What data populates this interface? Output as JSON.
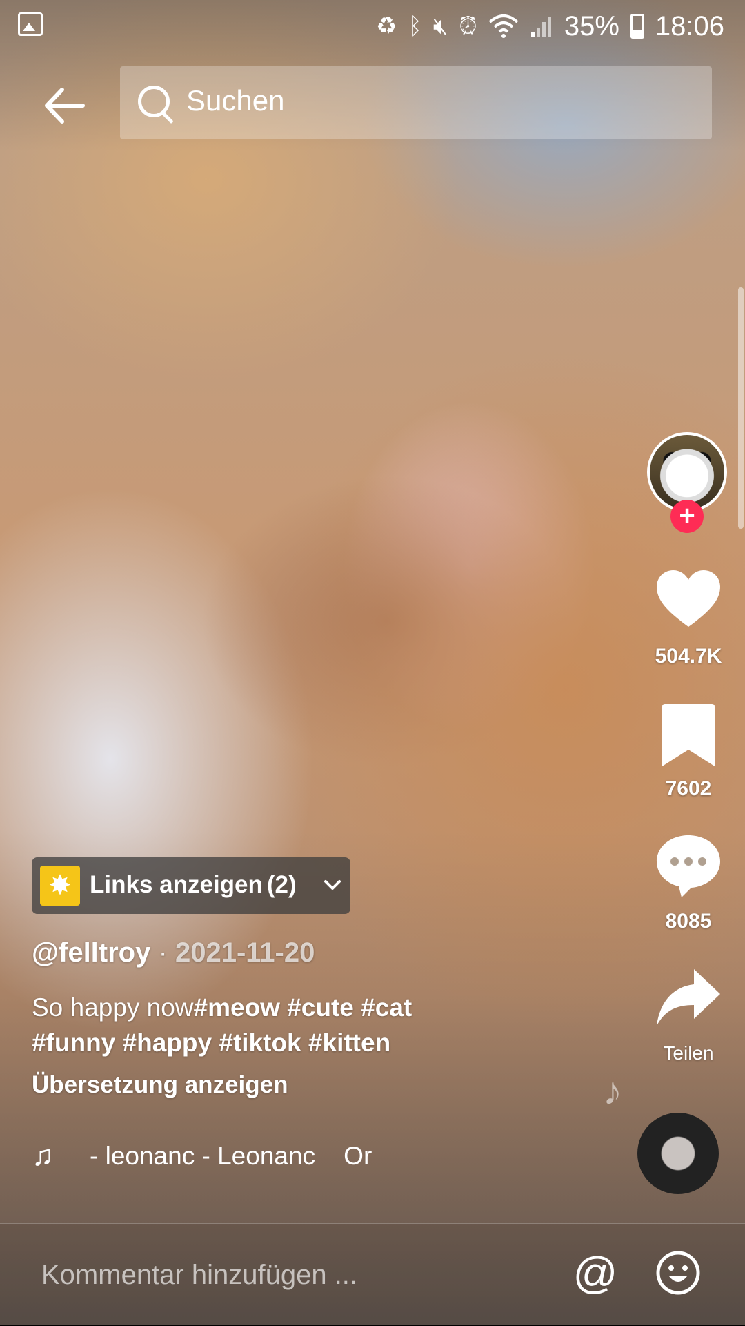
{
  "status_bar": {
    "battery": "35%",
    "time": "18:06",
    "icons": [
      "gallery-icon",
      "battery-saver-icon",
      "bluetooth-icon",
      "mute-icon",
      "alarm-icon",
      "wifi-icon",
      "signal-icon",
      "battery-icon"
    ]
  },
  "top_bar": {
    "search_placeholder": "Suchen"
  },
  "actions": {
    "likes": "504.7K",
    "saves": "7602",
    "comments": "8085",
    "share_label": "Teilen"
  },
  "links_pill": {
    "label": "Links anzeigen",
    "count": "(2)"
  },
  "post": {
    "author": "@felltroy",
    "separator": "·",
    "date": "2021-11-20",
    "caption_plain": "So happy now",
    "caption_tags_line1": "#meow #cute #cat",
    "caption_tags_line2": "#funny #happy #tiktok #kitten",
    "translate_label": "Übersetzung anzeigen",
    "music_text": "- leonanc - Leonanc    Or"
  },
  "comment_bar": {
    "placeholder": "Kommentar hinzufügen ..."
  },
  "colors": {
    "follow_badge": "#fe2c55",
    "links_icon": "#f5c518"
  }
}
